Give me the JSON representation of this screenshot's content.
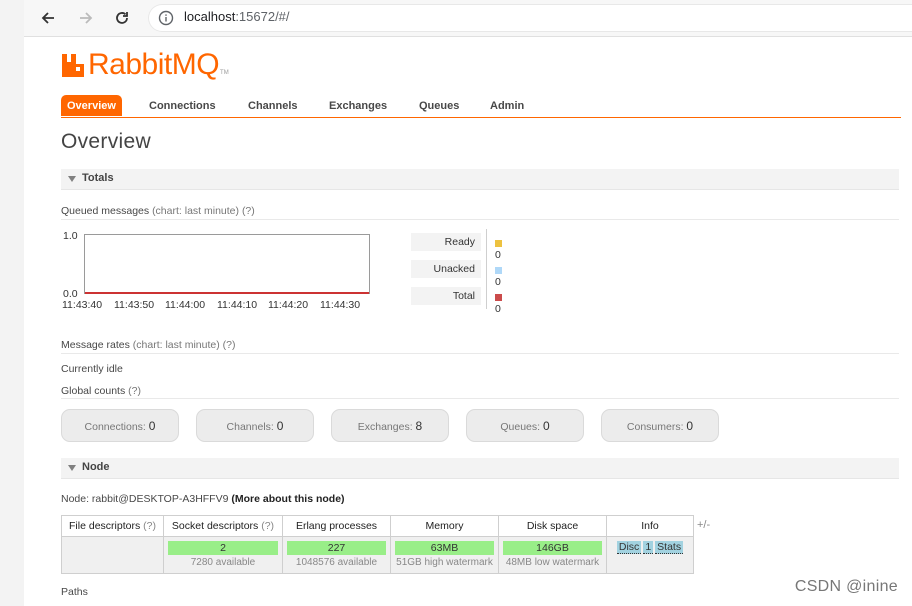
{
  "browser": {
    "url_host": "localhost",
    "url_rest": ":15672/#/",
    "icons": [
      "back-arrow-icon",
      "forward-arrow-icon",
      "reload-icon",
      "info-icon"
    ]
  },
  "logo": {
    "text": "RabbitMQ",
    "tm": "TM",
    "color": "#ff6600"
  },
  "tabs": [
    {
      "label": "Overview",
      "active": true
    },
    {
      "label": "Connections"
    },
    {
      "label": "Channels"
    },
    {
      "label": "Exchanges"
    },
    {
      "label": "Queues"
    },
    {
      "label": "Admin"
    }
  ],
  "page_title": "Overview",
  "totals": {
    "section_label": "Totals",
    "queued_title": "Queued messages",
    "queued_chart_hint": "(chart: last minute)",
    "help": "(?)",
    "chart_data": {
      "type": "line",
      "ylim": [
        0.0,
        1.0
      ],
      "y_ticks": [
        "1.0",
        "0.0"
      ],
      "x": [
        "11:43:40",
        "11:43:50",
        "11:44:00",
        "11:44:10",
        "11:44:20",
        "11:44:30"
      ],
      "series": [
        {
          "name": "Ready",
          "color": "#edc240",
          "value": "0"
        },
        {
          "name": "Unacked",
          "color": "#afd8f8",
          "value": "0"
        },
        {
          "name": "Total",
          "color": "#cb4b4b",
          "value": "0"
        }
      ]
    },
    "rates_title": "Message rates",
    "rates_hint": "(chart: last minute)",
    "currently_idle": "Currently idle",
    "global_counts": "Global counts",
    "counts": [
      {
        "label": "Connections:",
        "value": "0"
      },
      {
        "label": "Channels:",
        "value": "0"
      },
      {
        "label": "Exchanges:",
        "value": "8"
      },
      {
        "label": "Queues:",
        "value": "0"
      },
      {
        "label": "Consumers:",
        "value": "0"
      }
    ]
  },
  "node": {
    "section_label": "Node",
    "node_prefix": "Node: rabbit@DESKTOP-A3HFFV9",
    "more_link": "(More about this node)",
    "headers": {
      "file_descriptors": "File descriptors",
      "socket_descriptors": "Socket descriptors",
      "erlang_processes": "Erlang processes",
      "memory": "Memory",
      "disk_space": "Disk space",
      "info": "Info",
      "help": "(?)"
    },
    "values": {
      "socket_used": "2",
      "socket_avail": "7280 available",
      "erlang_used": "227",
      "erlang_avail": "1048576 available",
      "memory_used": "63MB",
      "memory_watermark": "51GB high watermark",
      "disk_used": "146GB",
      "disk_watermark": "48MB low watermark"
    },
    "info_badges": [
      "Disc",
      "1",
      "Stats"
    ],
    "plus_minus": "+/-",
    "paths_label": "Paths"
  },
  "watermark": "CSDN @inine"
}
